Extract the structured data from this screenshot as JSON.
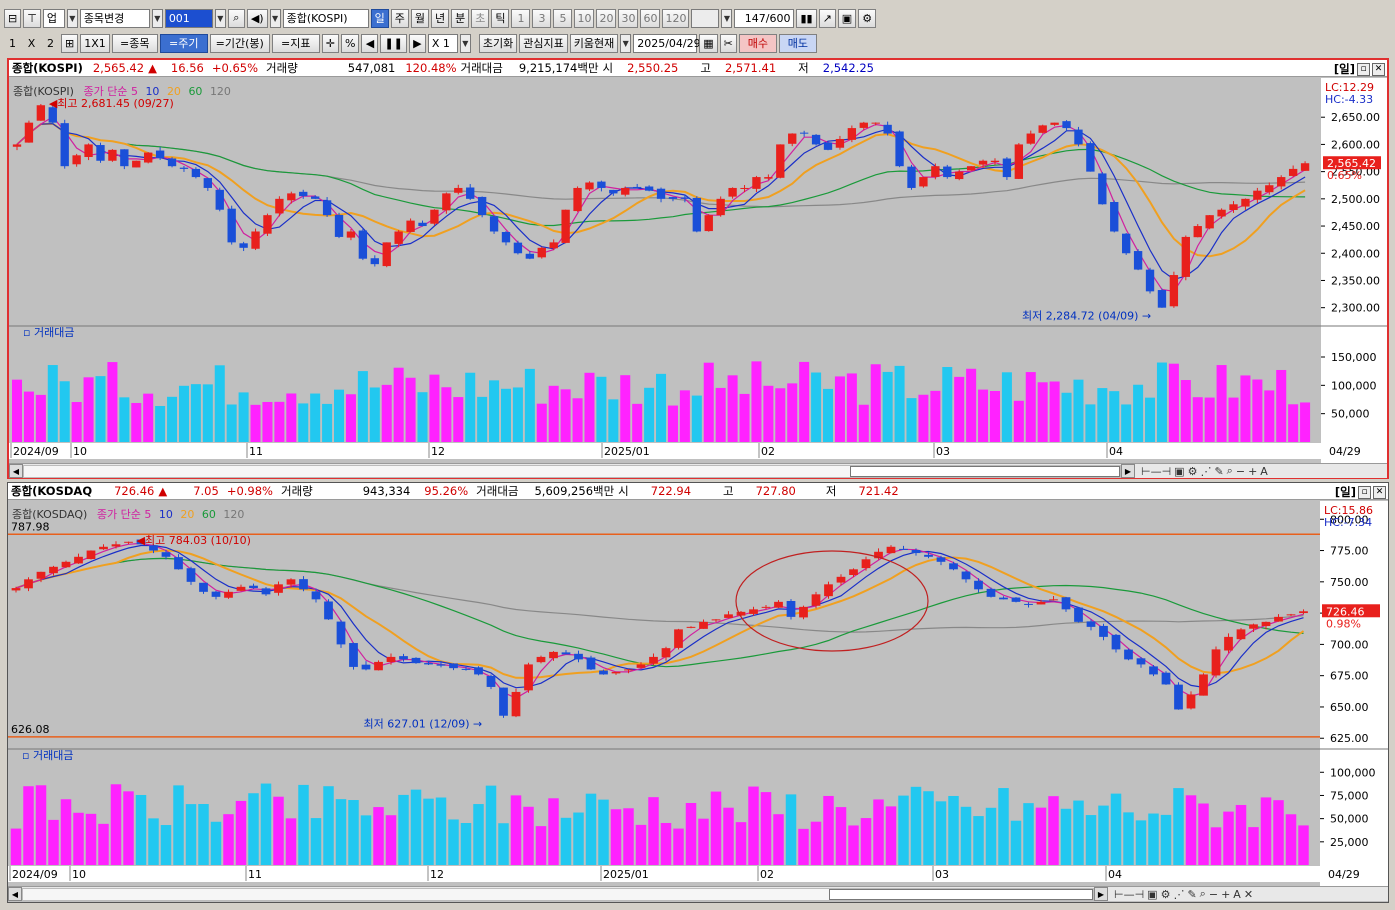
{
  "toolbar1": {
    "market": "업",
    "symbol_change": "종목변경",
    "code": "001",
    "name": "종합(KOSPI)",
    "periods": [
      "일",
      "주",
      "월",
      "년"
    ],
    "intraday": [
      "분",
      "초",
      "틱"
    ],
    "numbers": [
      "1",
      "3",
      "5",
      "10",
      "20",
      "30",
      "60",
      "120"
    ],
    "count": "147",
    "count_max": "/600"
  },
  "toolbar2": {
    "layout": [
      "1",
      "X",
      "2"
    ],
    "one": "1X1",
    "buttons": [
      "=종목",
      "=주기",
      "=기간(봉)",
      "=지표"
    ],
    "pct": "%",
    "zoom": "X 1",
    "reset": "초기화",
    "watch": "관심지표",
    "kiwoom": "키움현재",
    "date": "2025/04/29",
    "buy": "매수",
    "sell": "매도"
  },
  "kospi": {
    "header": {
      "name": "종합(KOSPI)",
      "price": "2,565.42",
      "arrow": "▲",
      "change": "16.56",
      "pct": "+0.65%",
      "vol_label": "거래량",
      "vol": "547,081",
      "vol_pct": "120.48%",
      "amt_label": "거래대금",
      "amt": "9,215,174백만",
      "open_label": "시",
      "open": "2,550.25",
      "high_label": "고",
      "high": "2,571.41",
      "low_label": "저",
      "low": "2,542.25",
      "period": "[일]"
    },
    "legend": {
      "title": "종합(KOSPI)",
      "ma_label": "종가 단순",
      "ma5": "5",
      "ma10": "10",
      "ma20": "20",
      "ma60": "60",
      "ma120": "120"
    },
    "lc": "LC:12.29",
    "hc": "HC:-4.33",
    "high_note": "최고 2,681.45 (09/27)",
    "low_note": "최저 2,284.72 (04/09)",
    "price_tag": "2,565.42",
    "pct_tag": "0.65%",
    "vol_title": "거래대금",
    "x_labels": [
      "2024/09",
      "10",
      "11",
      "12",
      "2025/01",
      "02",
      "03",
      "04"
    ],
    "last_date": "04/29"
  },
  "kosdaq": {
    "header": {
      "name": "종합(KOSDAQ",
      "price": "726.46",
      "arrow": "▲",
      "change": "7.05",
      "pct": "+0.98%",
      "vol_label": "거래량",
      "vol": "943,334",
      "vol_pct": "95.26%",
      "amt_label": "거래대금",
      "amt": "5,609,256백만",
      "open_label": "시",
      "open": "722.94",
      "high_label": "고",
      "high": "727.80",
      "low_label": "저",
      "low": "721.42",
      "period": "[일]"
    },
    "legend": {
      "title": "종합(KOSDAQ)",
      "ma_label": "종가 단순",
      "ma5": "5",
      "ma10": "10",
      "ma20": "20",
      "ma60": "60",
      "ma120": "120"
    },
    "lc": "LC:15.86",
    "hc": "HC:-7.34",
    "high_note": "최고 784.03 (10/10)",
    "low_note": "최저 627.01 (12/09)",
    "level_hi": "787.98",
    "level_lo": "626.08",
    "price_tag": "726.46",
    "pct_tag": "0.98%",
    "vol_title": "거래대금",
    "x_labels": [
      "2024/09",
      "10",
      "11",
      "12",
      "2025/01",
      "02",
      "03",
      "04"
    ],
    "last_date": "04/29"
  },
  "chart_data": [
    {
      "type": "candlestick",
      "title": "종합(KOSPI)",
      "y_ticks": [
        "2,650.00",
        "2,600.00",
        "2,550.00",
        "2,500.00",
        "2,450.00",
        "2,400.00",
        "2,350.00",
        "2,300.00"
      ],
      "ylim": [
        2270,
        2700
      ],
      "x_labels": [
        "2024/09",
        "10",
        "11",
        "12",
        "2025/01",
        "02",
        "03",
        "04"
      ],
      "close_path": [
        2600,
        2640,
        2672,
        2640,
        2560,
        2580,
        2600,
        2570,
        2590,
        2560,
        2570,
        2585,
        2575,
        2560,
        2555,
        2540,
        2520,
        2480,
        2420,
        2410,
        2440,
        2470,
        2500,
        2510,
        2505,
        2500,
        2470,
        2430,
        2440,
        2390,
        2380,
        2420,
        2440,
        2460,
        2450,
        2480,
        2510,
        2520,
        2500,
        2470,
        2440,
        2420,
        2400,
        2390,
        2410,
        2420,
        2480,
        2520,
        2530,
        2520,
        2510,
        2520,
        2520,
        2515,
        2500,
        2500,
        2500,
        2440,
        2470,
        2500,
        2520,
        2520,
        2540,
        2540,
        2600,
        2620,
        2620,
        2600,
        2590,
        2610,
        2630,
        2640,
        2640,
        2620,
        2560,
        2520,
        2540,
        2560,
        2540,
        2550,
        2560,
        2570,
        2570,
        2540,
        2600,
        2620,
        2635,
        2640,
        2630,
        2600,
        2550,
        2490,
        2440,
        2400,
        2370,
        2330,
        2300,
        2360,
        2430,
        2450,
        2470,
        2480,
        2490,
        2500,
        2515,
        2525,
        2540,
        2555,
        2565.42
      ],
      "volume_ticks": [
        "150,000",
        "100,000",
        "50,000"
      ],
      "volume_max": 180000
    },
    {
      "type": "candlestick",
      "title": "종합(KOSDAQ)",
      "y_ticks": [
        "800.00",
        "775.00",
        "750.00",
        "725.00",
        "700.00",
        "675.00",
        "650.00",
        "625.00"
      ],
      "ylim": [
        618,
        805
      ],
      "x_labels": [
        "2024/09",
        "10",
        "11",
        "12",
        "2025/01",
        "02",
        "03",
        "04"
      ],
      "close_path": [
        745,
        752,
        758,
        762,
        766,
        770,
        775,
        778,
        780,
        782,
        780,
        775,
        770,
        760,
        750,
        742,
        738,
        742,
        746,
        745,
        740,
        748,
        752,
        744,
        736,
        720,
        700,
        682,
        680,
        686,
        690,
        688,
        685,
        684,
        683,
        681,
        680,
        676,
        666,
        643,
        662,
        684,
        690,
        694,
        692,
        688,
        680,
        676,
        678,
        680,
        684,
        690,
        697,
        712,
        714,
        718,
        720,
        724,
        726,
        728,
        730,
        734,
        722,
        730,
        740,
        748,
        754,
        760,
        768,
        774,
        778,
        776,
        773,
        770,
        766,
        760,
        752,
        744,
        738,
        736,
        734,
        732,
        734,
        736,
        728,
        718,
        714,
        706,
        696,
        688,
        684,
        676,
        668,
        648,
        660,
        676,
        696,
        706,
        712,
        716,
        718,
        722,
        724,
        726.46
      ],
      "volume_ticks": [
        "100,000",
        "75,000",
        "50,000",
        "25,000"
      ],
      "volume_max": 110000
    }
  ],
  "colors": {
    "up": "#e8201c",
    "down": "#1a4fd8",
    "ma5": "#d020a0",
    "ma10": "#1a2fc8",
    "ma20": "#f0a020",
    "ma60": "#1a9a3a",
    "ma120": "#888888",
    "vol_a": "#ff22ff",
    "vol_b": "#22c8f0"
  }
}
